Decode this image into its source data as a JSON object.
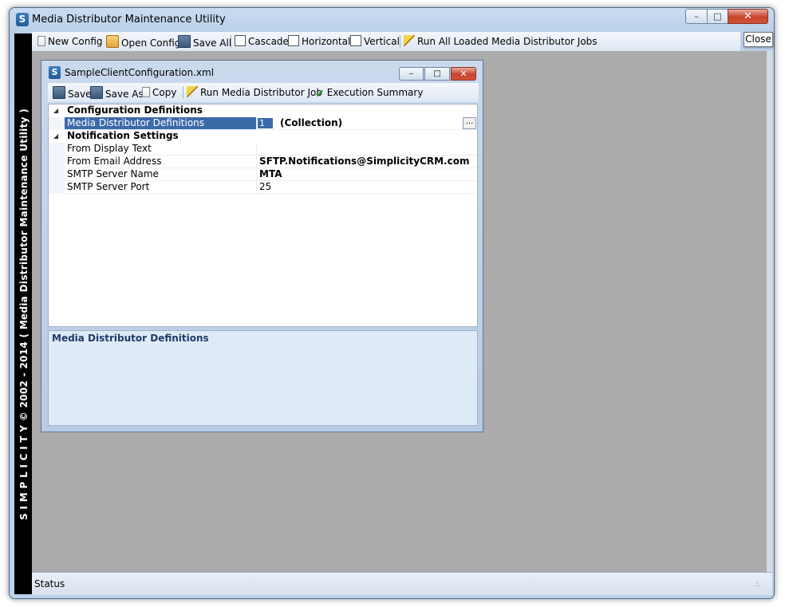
{
  "window": {
    "title": "Media Distributor Maintenance Utility",
    "app_icon_letter": "S",
    "minimize": "–",
    "maximize": "□",
    "close": "✕",
    "close_tooltip": "Close"
  },
  "toolbar": {
    "new_config": "New Config",
    "open_config": "Open Config",
    "save_all": "Save All",
    "cascade": "Cascade",
    "horizontal": "Horizontal",
    "vertical": "Vertical",
    "run_all": "Run All Loaded Media Distributor Jobs"
  },
  "branding": {
    "text": "S I M P L I C I T Y  ©  2002 - 2014  ( Media Distributor Maintenance Utility )"
  },
  "child": {
    "title": "SampleClientConfiguration.xml",
    "icon_letter": "S",
    "minimize": "–",
    "maximize": "□",
    "close": "✕",
    "toolbar": {
      "save": "Save",
      "save_as": "Save As",
      "copy": "Copy",
      "run_job": "Run Media Distributor Job",
      "execution_summary": "Execution Summary"
    },
    "grid": {
      "categories": [
        {
          "name": "Configuration Definitions",
          "properties": [
            {
              "name": "Media Distributor Definitions",
              "value": "(Collection)",
              "badge": "1",
              "ellipsis": "..."
            }
          ]
        },
        {
          "name": "Notification Settings",
          "properties": [
            {
              "name": "From Display Text",
              "value": ""
            },
            {
              "name": "From Email Address",
              "value": "SFTP.Notifications@SimplicityCRM.com"
            },
            {
              "name": "SMTP Server Name",
              "value": "MTA"
            },
            {
              "name": "SMTP Server Port",
              "value": "25"
            }
          ]
        }
      ],
      "toggle": "◢"
    },
    "description": {
      "title": "Media Distributor Definitions"
    }
  },
  "statusbar": {
    "text": "Status",
    "grip": "∴"
  },
  "colors": {
    "selection": "#3b6aa8",
    "mdi_background": "#ababab",
    "close_red": "#c6442c"
  }
}
